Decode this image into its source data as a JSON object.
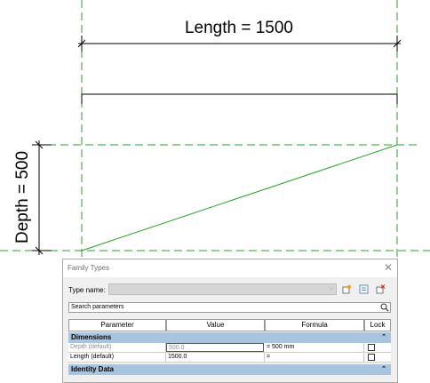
{
  "drawing": {
    "length_dimension": "Length = 1500",
    "depth_dimension": "Depth = 500",
    "colors": {
      "reference_plane": "#2aa02a",
      "geometry_line": "#000000"
    }
  },
  "dialog": {
    "title": "Family Types",
    "close_glyph": "✕",
    "type_name_label": "Type name:",
    "type_name_value": "",
    "search_placeholder": "Search parameters",
    "columns": [
      "Parameter",
      "Value",
      "Formula",
      "Lock"
    ],
    "groups": [
      {
        "name": "Dimensions",
        "toggle": "⌃",
        "rows": [
          {
            "parameter": "Depth (default)",
            "value": "500.0",
            "formula": "= 500 mm",
            "locked": false
          },
          {
            "parameter": "Length (default)",
            "value": "1500.0",
            "formula": "=",
            "locked": false
          }
        ]
      },
      {
        "name": "Identity Data",
        "toggle": "⌃",
        "rows": []
      }
    ],
    "header_color": "#a9c4de"
  }
}
